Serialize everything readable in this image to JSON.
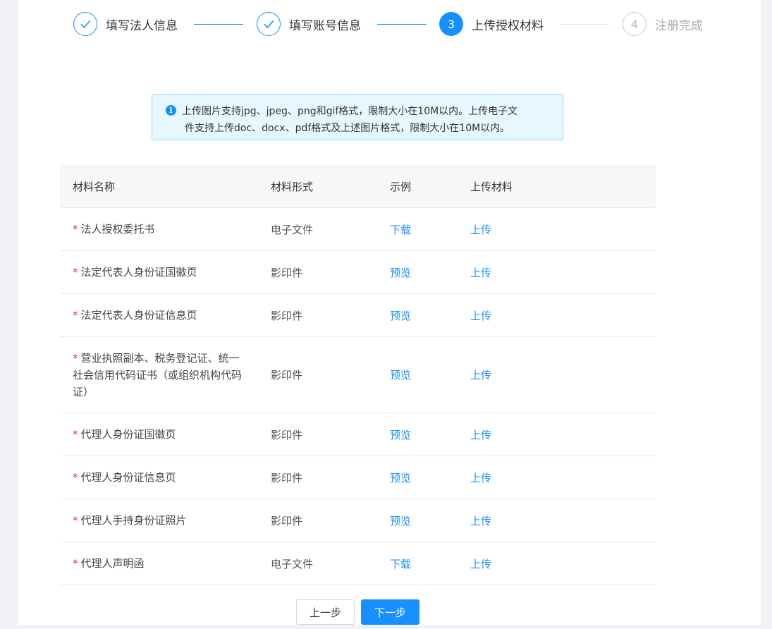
{
  "steps": [
    {
      "number": "1",
      "title": "填写法人信息",
      "status": "done"
    },
    {
      "number": "2",
      "title": "填写账号信息",
      "status": "done"
    },
    {
      "number": "3",
      "title": "上传授权材料",
      "status": "active"
    },
    {
      "number": "4",
      "title": "注册完成",
      "status": "wait"
    }
  ],
  "alert": {
    "icon": "info-icon",
    "line1": "上传图片支持jpg、jpeg、png和gif格式，限制大小在10M以内。上传电子文",
    "line2": "件支持上传doc、docx、pdf格式及上述图片格式，限制大小在10M以内。"
  },
  "table": {
    "headers": [
      "材料名称",
      "材料形式",
      "示例",
      "上传材料"
    ],
    "rows": [
      {
        "required": "*",
        "name": "法人授权委托书",
        "form": "电子文件",
        "example": "下载",
        "upload": "上传"
      },
      {
        "required": "*",
        "name": "法定代表人身份证国徽页",
        "form": "影印件",
        "example": "预览",
        "upload": "上传"
      },
      {
        "required": "*",
        "name": "法定代表人身份证信息页",
        "form": "影印件",
        "example": "预览",
        "upload": "上传"
      },
      {
        "required": "*",
        "name": "营业执照副本、税务登记证、统一社会信用代码证书（或组织机构代码证）",
        "form": "影印件",
        "example": "预览",
        "upload": "上传"
      },
      {
        "required": "*",
        "name": "代理人身份证国徽页",
        "form": "影印件",
        "example": "预览",
        "upload": "上传"
      },
      {
        "required": "*",
        "name": "代理人身份证信息页",
        "form": "影印件",
        "example": "预览",
        "upload": "上传"
      },
      {
        "required": "*",
        "name": "代理人手持身份证照片",
        "form": "影印件",
        "example": "预览",
        "upload": "上传"
      },
      {
        "required": "*",
        "name": "代理人声明函",
        "form": "电子文件",
        "example": "下载",
        "upload": "上传"
      }
    ]
  },
  "buttons": {
    "prev": "上一步",
    "next": "下一步"
  },
  "colors": {
    "primary": "#1890ff",
    "required": "#f5222d",
    "alert_bg": "#e6f7ff"
  }
}
